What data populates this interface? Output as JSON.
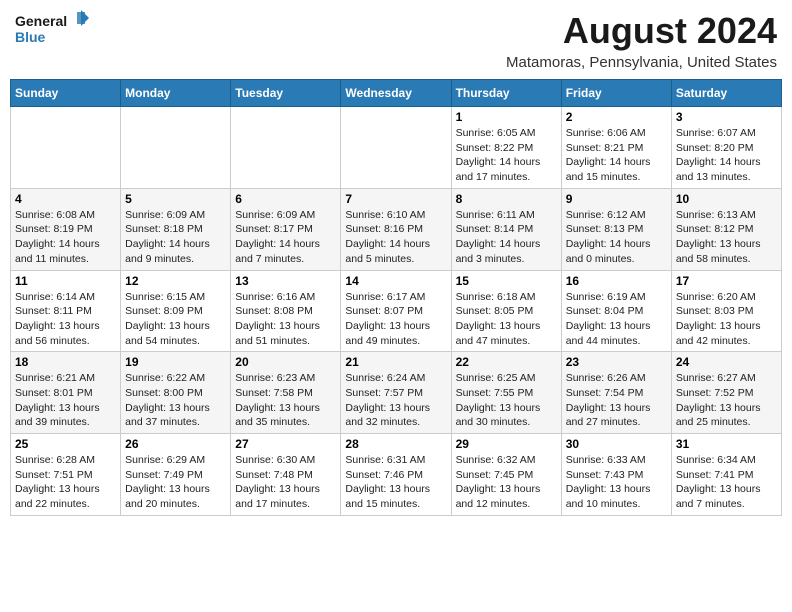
{
  "logo": {
    "line1": "General",
    "line2": "Blue"
  },
  "title": "August 2024",
  "location": "Matamoras, Pennsylvania, United States",
  "days_of_week": [
    "Sunday",
    "Monday",
    "Tuesday",
    "Wednesday",
    "Thursday",
    "Friday",
    "Saturday"
  ],
  "weeks": [
    [
      {
        "day": "",
        "info": ""
      },
      {
        "day": "",
        "info": ""
      },
      {
        "day": "",
        "info": ""
      },
      {
        "day": "",
        "info": ""
      },
      {
        "day": "1",
        "info": "Sunrise: 6:05 AM\nSunset: 8:22 PM\nDaylight: 14 hours\nand 17 minutes."
      },
      {
        "day": "2",
        "info": "Sunrise: 6:06 AM\nSunset: 8:21 PM\nDaylight: 14 hours\nand 15 minutes."
      },
      {
        "day": "3",
        "info": "Sunrise: 6:07 AM\nSunset: 8:20 PM\nDaylight: 14 hours\nand 13 minutes."
      }
    ],
    [
      {
        "day": "4",
        "info": "Sunrise: 6:08 AM\nSunset: 8:19 PM\nDaylight: 14 hours\nand 11 minutes."
      },
      {
        "day": "5",
        "info": "Sunrise: 6:09 AM\nSunset: 8:18 PM\nDaylight: 14 hours\nand 9 minutes."
      },
      {
        "day": "6",
        "info": "Sunrise: 6:09 AM\nSunset: 8:17 PM\nDaylight: 14 hours\nand 7 minutes."
      },
      {
        "day": "7",
        "info": "Sunrise: 6:10 AM\nSunset: 8:16 PM\nDaylight: 14 hours\nand 5 minutes."
      },
      {
        "day": "8",
        "info": "Sunrise: 6:11 AM\nSunset: 8:14 PM\nDaylight: 14 hours\nand 3 minutes."
      },
      {
        "day": "9",
        "info": "Sunrise: 6:12 AM\nSunset: 8:13 PM\nDaylight: 14 hours\nand 0 minutes."
      },
      {
        "day": "10",
        "info": "Sunrise: 6:13 AM\nSunset: 8:12 PM\nDaylight: 13 hours\nand 58 minutes."
      }
    ],
    [
      {
        "day": "11",
        "info": "Sunrise: 6:14 AM\nSunset: 8:11 PM\nDaylight: 13 hours\nand 56 minutes."
      },
      {
        "day": "12",
        "info": "Sunrise: 6:15 AM\nSunset: 8:09 PM\nDaylight: 13 hours\nand 54 minutes."
      },
      {
        "day": "13",
        "info": "Sunrise: 6:16 AM\nSunset: 8:08 PM\nDaylight: 13 hours\nand 51 minutes."
      },
      {
        "day": "14",
        "info": "Sunrise: 6:17 AM\nSunset: 8:07 PM\nDaylight: 13 hours\nand 49 minutes."
      },
      {
        "day": "15",
        "info": "Sunrise: 6:18 AM\nSunset: 8:05 PM\nDaylight: 13 hours\nand 47 minutes."
      },
      {
        "day": "16",
        "info": "Sunrise: 6:19 AM\nSunset: 8:04 PM\nDaylight: 13 hours\nand 44 minutes."
      },
      {
        "day": "17",
        "info": "Sunrise: 6:20 AM\nSunset: 8:03 PM\nDaylight: 13 hours\nand 42 minutes."
      }
    ],
    [
      {
        "day": "18",
        "info": "Sunrise: 6:21 AM\nSunset: 8:01 PM\nDaylight: 13 hours\nand 39 minutes."
      },
      {
        "day": "19",
        "info": "Sunrise: 6:22 AM\nSunset: 8:00 PM\nDaylight: 13 hours\nand 37 minutes."
      },
      {
        "day": "20",
        "info": "Sunrise: 6:23 AM\nSunset: 7:58 PM\nDaylight: 13 hours\nand 35 minutes."
      },
      {
        "day": "21",
        "info": "Sunrise: 6:24 AM\nSunset: 7:57 PM\nDaylight: 13 hours\nand 32 minutes."
      },
      {
        "day": "22",
        "info": "Sunrise: 6:25 AM\nSunset: 7:55 PM\nDaylight: 13 hours\nand 30 minutes."
      },
      {
        "day": "23",
        "info": "Sunrise: 6:26 AM\nSunset: 7:54 PM\nDaylight: 13 hours\nand 27 minutes."
      },
      {
        "day": "24",
        "info": "Sunrise: 6:27 AM\nSunset: 7:52 PM\nDaylight: 13 hours\nand 25 minutes."
      }
    ],
    [
      {
        "day": "25",
        "info": "Sunrise: 6:28 AM\nSunset: 7:51 PM\nDaylight: 13 hours\nand 22 minutes."
      },
      {
        "day": "26",
        "info": "Sunrise: 6:29 AM\nSunset: 7:49 PM\nDaylight: 13 hours\nand 20 minutes."
      },
      {
        "day": "27",
        "info": "Sunrise: 6:30 AM\nSunset: 7:48 PM\nDaylight: 13 hours\nand 17 minutes."
      },
      {
        "day": "28",
        "info": "Sunrise: 6:31 AM\nSunset: 7:46 PM\nDaylight: 13 hours\nand 15 minutes."
      },
      {
        "day": "29",
        "info": "Sunrise: 6:32 AM\nSunset: 7:45 PM\nDaylight: 13 hours\nand 12 minutes."
      },
      {
        "day": "30",
        "info": "Sunrise: 6:33 AM\nSunset: 7:43 PM\nDaylight: 13 hours\nand 10 minutes."
      },
      {
        "day": "31",
        "info": "Sunrise: 6:34 AM\nSunset: 7:41 PM\nDaylight: 13 hours\nand 7 minutes."
      }
    ]
  ]
}
